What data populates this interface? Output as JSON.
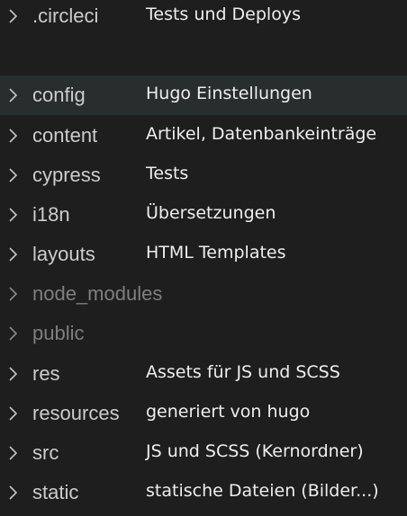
{
  "colors": {
    "background": "#1e1e1e",
    "row_highlight": "#2a2d2e",
    "folder_text": "#cccccc",
    "ignored_folder_text": "#7f7f7f",
    "description_text": "#eeeeee",
    "chevron": "#c5c5c5"
  },
  "explorer": {
    "items": [
      {
        "name": ".circleci",
        "description": "Tests und Deploys",
        "icon": "chevron-right-icon"
      },
      {
        "name": "config",
        "description": "Hugo Einstellungen",
        "icon": "chevron-right-icon",
        "selected": true
      },
      {
        "name": "content",
        "description": "Artikel, Datenbankeinträge",
        "icon": "chevron-right-icon"
      },
      {
        "name": "cypress",
        "description": "Tests",
        "icon": "chevron-right-icon"
      },
      {
        "name": "i18n",
        "description": "Übersetzungen",
        "icon": "chevron-right-icon"
      },
      {
        "name": "layouts",
        "description": "HTML Templates",
        "icon": "chevron-right-icon"
      },
      {
        "name": "node_modules",
        "description": "",
        "icon": "chevron-right-icon",
        "dimmed": true
      },
      {
        "name": "public",
        "description": "",
        "icon": "chevron-right-icon",
        "dimmed": true
      },
      {
        "name": "res",
        "description": "Assets für JS und SCSS",
        "icon": "chevron-right-icon"
      },
      {
        "name": "resources",
        "description": "generiert von hugo",
        "icon": "chevron-right-icon"
      },
      {
        "name": "src",
        "description": "JS und SCSS (Kernordner)",
        "icon": "chevron-right-icon"
      },
      {
        "name": "static",
        "description": "statische Dateien (Bilder...)",
        "icon": "chevron-right-icon"
      }
    ]
  }
}
